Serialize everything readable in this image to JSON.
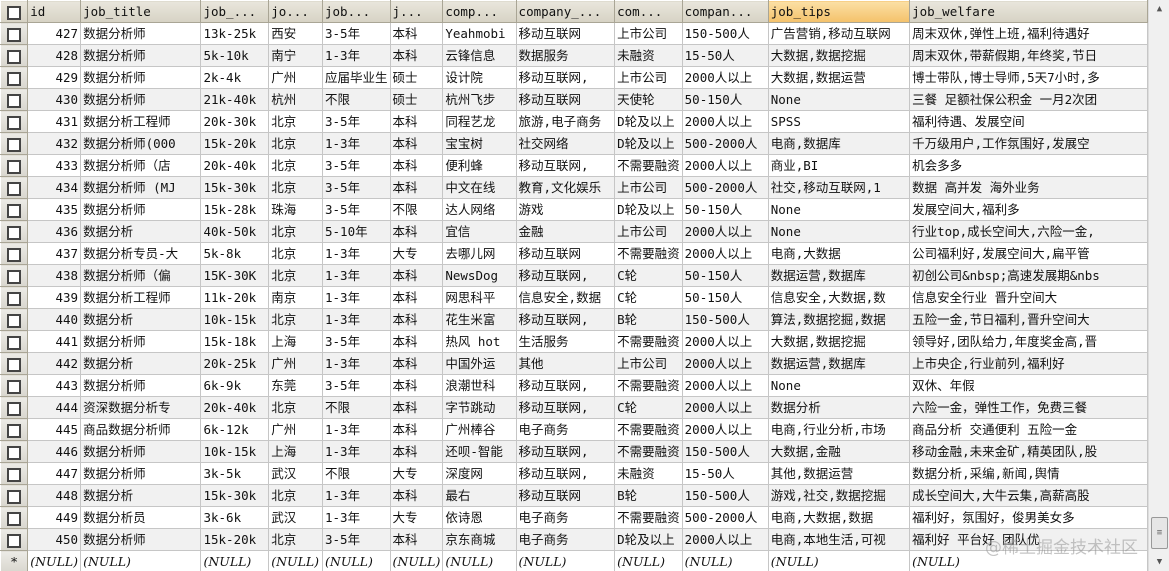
{
  "columns": [
    "id",
    "job_title",
    "job_...",
    "jo...",
    "job...",
    "j...",
    "comp...",
    "company_...",
    "com...",
    "compan...",
    "job_tips",
    "job_welfare"
  ],
  "sorted_column_index": 10,
  "rows": [
    [
      "427",
      "数据分析师",
      "13k-25k",
      "西安",
      "3-5年",
      "本科",
      "Yeahmobi",
      "移动互联网",
      "上市公司",
      "150-500人",
      "广告营销,移动互联网",
      "周末双休,弹性上班,福利待遇好"
    ],
    [
      "428",
      "数据分析师",
      "5k-10k",
      "南宁",
      "1-3年",
      "本科",
      "云锋信息",
      "数据服务",
      "未融资",
      "15-50人",
      "大数据,数据挖掘",
      "周末双休,带薪假期,年终奖,节日"
    ],
    [
      "429",
      "数据分析师",
      "2k-4k",
      "广州",
      "应届毕业生",
      "硕士",
      "设计院",
      "移动互联网,",
      "上市公司",
      "2000人以上",
      "大数据,数据运营",
      "博士带队,博士导师,5天7小时,多"
    ],
    [
      "430",
      "数据分析师",
      "21k-40k",
      "杭州",
      "不限",
      "硕士",
      "杭州飞步",
      "移动互联网",
      "天使轮",
      "50-150人",
      "None",
      "三餐 足额社保公积金 一月2次团"
    ],
    [
      "431",
      "数据分析工程师",
      "20k-30k",
      "北京",
      "3-5年",
      "本科",
      "同程艺龙",
      "旅游,电子商务",
      "D轮及以上",
      "2000人以上",
      "SPSS",
      "福利待遇、发展空间"
    ],
    [
      "432",
      "数据分析师(000",
      "15k-20k",
      "北京",
      "1-3年",
      "本科",
      "宝宝树",
      "社交网络",
      "D轮及以上",
      "500-2000人",
      "电商,数据库",
      "千万级用户,工作氛围好,发展空"
    ],
    [
      "433",
      "数据分析师（店",
      "20k-40k",
      "北京",
      "3-5年",
      "本科",
      "便利蜂",
      "移动互联网,",
      "不需要融资",
      "2000人以上",
      "商业,BI",
      "机会多多"
    ],
    [
      "434",
      "数据分析师 (MJ",
      "15k-30k",
      "北京",
      "3-5年",
      "本科",
      "中文在线",
      "教育,文化娱乐",
      "上市公司",
      "500-2000人",
      "社交,移动互联网,1",
      "数据 高并发 海外业务"
    ],
    [
      "435",
      "数据分析师",
      "15k-28k",
      "珠海",
      "3-5年",
      "不限",
      "达人网络",
      "游戏",
      "D轮及以上",
      "50-150人",
      "None",
      "发展空间大,福利多"
    ],
    [
      "436",
      "数据分析",
      "40k-50k",
      "北京",
      "5-10年",
      "本科",
      "宜信",
      "金融",
      "上市公司",
      "2000人以上",
      "None",
      "行业top,成长空间大,六险一金,"
    ],
    [
      "437",
      "数据分析专员-大",
      "5k-8k",
      "北京",
      "1-3年",
      "大专",
      "去哪儿网",
      "移动互联网",
      "不需要融资",
      "2000人以上",
      "电商,大数据",
      "公司福利好,发展空间大,扁平管"
    ],
    [
      "438",
      "数据分析师（偏",
      "15K-30K",
      "北京",
      "1-3年",
      "本科",
      "NewsDog",
      "移动互联网,",
      "C轮",
      "50-150人",
      "数据运营,数据库",
      "初创公司&nbsp;高速发展期&nbs"
    ],
    [
      "439",
      "数据分析工程师",
      "11k-20k",
      "南京",
      "1-3年",
      "本科",
      "网思科平",
      "信息安全,数据",
      "C轮",
      "50-150人",
      "信息安全,大数据,数",
      "信息安全行业 晋升空间大"
    ],
    [
      "440",
      "数据分析",
      "10k-15k",
      "北京",
      "1-3年",
      "本科",
      "花生米富",
      "移动互联网,",
      "B轮",
      "150-500人",
      "算法,数据挖掘,数据",
      "五险一金,节日福利,晋升空间大"
    ],
    [
      "441",
      "数据分析师",
      "15k-18k",
      "上海",
      "3-5年",
      "本科",
      "热风 hot",
      "生活服务",
      "不需要融资",
      "2000人以上",
      "大数据,数据挖掘",
      "领导好,团队给力,年度奖金高,晋"
    ],
    [
      "442",
      "数据分析",
      "20k-25k",
      "广州",
      "1-3年",
      "本科",
      "中国外运",
      "其他",
      "上市公司",
      "2000人以上",
      "数据运营,数据库",
      "上市央企,行业前列,福利好"
    ],
    [
      "443",
      "数据分析师",
      "6k-9k",
      "东莞",
      "3-5年",
      "本科",
      "浪潮世科",
      "移动互联网,",
      "不需要融资",
      "2000人以上",
      "None",
      "双休、年假"
    ],
    [
      "444",
      "资深数据分析专",
      "20k-40k",
      "北京",
      "不限",
      "本科",
      "字节跳动",
      "移动互联网,",
      "C轮",
      "2000人以上",
      "数据分析",
      "六险一金，弹性工作，免费三餐"
    ],
    [
      "445",
      "商品数据分析师",
      "6k-12k",
      "广州",
      "1-3年",
      "本科",
      "广州棒谷",
      "电子商务",
      "不需要融资",
      "2000人以上",
      "电商,行业分析,市场",
      "商品分析 交通便利 五险一金"
    ],
    [
      "446",
      "数据分析师",
      "10k-15k",
      "上海",
      "1-3年",
      "本科",
      "还呗-智能",
      "移动互联网,",
      "不需要融资",
      "150-500人",
      "大数据,金融",
      "移动金融,未来金矿,精英团队,股"
    ],
    [
      "447",
      "数据分析师",
      "3k-5k",
      "武汉",
      "不限",
      "大专",
      "深度网",
      "移动互联网,",
      "未融资",
      "15-50人",
      "其他,数据运营",
      "数据分析,采编,新闻,舆情"
    ],
    [
      "448",
      "数据分析",
      "15k-30k",
      "北京",
      "1-3年",
      "本科",
      "最右",
      "移动互联网",
      "B轮",
      "150-500人",
      "游戏,社交,数据挖掘",
      "成长空间大,大牛云集,高薪高股"
    ],
    [
      "449",
      "数据分析员",
      "3k-6k",
      "武汉",
      "1-3年",
      "大专",
      "依诗恩",
      "电子商务",
      "不需要融资",
      "500-2000人",
      "电商,大数据,数据",
      "福利好，氛围好，俊男美女多"
    ],
    [
      "450",
      "数据分析师",
      "15k-20k",
      "北京",
      "3-5年",
      "本科",
      "京东商城",
      "电子商务",
      "D轮及以上",
      "2000人以上",
      "电商,本地生活,可视",
      "福利好 平台好 团队优"
    ]
  ],
  "new_row_marker": "*",
  "null_text": "(NULL)",
  "watermark": "@稀土掘金技术社区"
}
